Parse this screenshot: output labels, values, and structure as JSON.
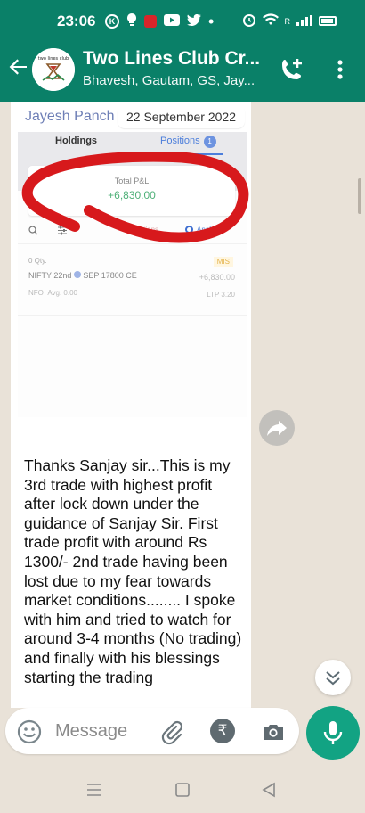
{
  "status_bar": {
    "time": "23:06",
    "left_icons": [
      "k-circle-icon",
      "bulb-icon",
      "red-app-icon",
      "youtube-icon",
      "twitter-icon",
      "dot-icon"
    ],
    "right_icons": [
      "alarm-icon",
      "wifi-icon",
      "signal-icon",
      "battery-icon"
    ],
    "signal_label": "R"
  },
  "header": {
    "title": "Two Lines Club Cr...",
    "subtitle": "Bhavesh, Gautam, GS, Jay...",
    "avatar_text": "two lines club",
    "colors": {
      "bar": "#0a8068",
      "text": "#ffffff"
    }
  },
  "message": {
    "sender": "Jayesh Panch",
    "date_chip": "22 September 2022",
    "image": {
      "tabs": [
        {
          "label": "Holdings"
        },
        {
          "label": "Positions",
          "count": "1"
        }
      ],
      "pnl_label": "Total P&L",
      "pnl_value": "+6,830.00",
      "analytics_label": "Analytics",
      "hidden_label": "...ntions",
      "position": {
        "qty": "0 Qty.",
        "product": "MIS",
        "symbol": "NIFTY 22nd",
        "contract": "SEP 17800 CE",
        "pnl": "+6,830.00",
        "exchange": "NFO",
        "avg": "Avg. 0.00",
        "ltp": "LTP 3.20"
      }
    },
    "text": "Thanks Sanjay sir...This is my 3rd trade with highest profit after lock down under the guidance of Sanjay Sir. First trade profit with around Rs 1300/-     2nd trade having been lost due to my fear towards market conditions........ I spoke with him and tried to watch for around 3-4 months (No trading) and finally with his blessings starting the trading"
  },
  "composer": {
    "placeholder": "Message",
    "rupee_symbol": "₹",
    "icons": [
      "emoji-icon",
      "attach-icon",
      "rupee-icon",
      "camera-icon",
      "mic-icon"
    ]
  },
  "navbar": {
    "icons": [
      "menu-icon",
      "home-icon",
      "back-triangle-icon"
    ]
  }
}
